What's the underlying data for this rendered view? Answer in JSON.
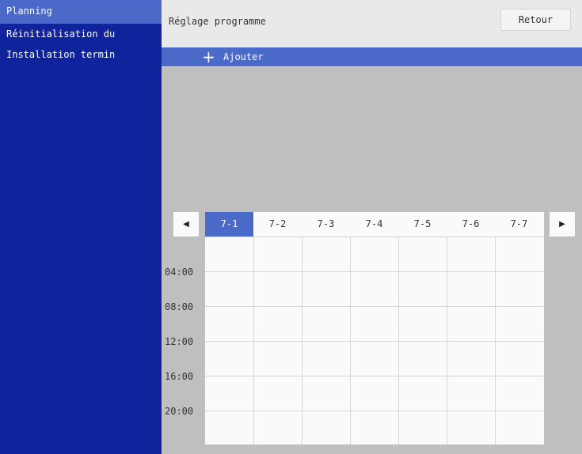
{
  "sidebar": {
    "items": [
      {
        "label": "Planning",
        "active": true
      },
      {
        "label": "Réinitialisation du",
        "active": false
      },
      {
        "label": "Installation termin",
        "active": false
      }
    ]
  },
  "header": {
    "title": "Réglage programme",
    "back_label": "Retour"
  },
  "add_bar": {
    "icon": "+",
    "label": "Ajouter"
  },
  "calendar": {
    "prev_icon": "◀",
    "next_icon": "▶",
    "days": [
      "7-1",
      "7-2",
      "7-3",
      "7-4",
      "7-5",
      "7-6",
      "7-7"
    ],
    "selected_day": "7-1",
    "times": [
      "04:00",
      "08:00",
      "12:00",
      "16:00",
      "20:00"
    ]
  },
  "colors": {
    "sidebar_bg": "#0f239c",
    "accent": "#4b69c9",
    "content_bg": "#bfbfbf"
  }
}
